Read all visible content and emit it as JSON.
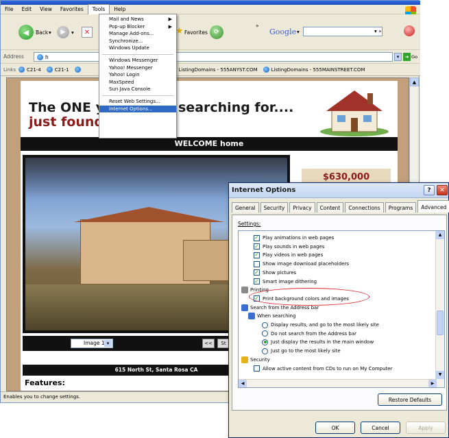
{
  "menubar": {
    "items": [
      "File",
      "Edit",
      "View",
      "Favorites",
      "Tools",
      "Help"
    ]
  },
  "toolbar": {
    "back": "Back",
    "favorites": "Favorites",
    "google": "Google"
  },
  "address": {
    "label": "Address",
    "value": "h",
    "go": "Go"
  },
  "links": {
    "label": "Links",
    "items": [
      "C21-4",
      "C21-1",
      "ListingDomains - 555ANYST.COM",
      "ListingDomains - 555MAINSTREET.COM"
    ]
  },
  "tools_menu": {
    "group1": [
      "Mail and News",
      "Pop-up Blocker",
      "Manage Add-ons...",
      "Synchronize...",
      "Windows Update"
    ],
    "group2": [
      "Windows Messenger",
      "Yahoo! Messenger",
      "Yahoo! Login",
      "MaxSpeed",
      "Sun Java Console"
    ],
    "group3": [
      "Reset Web Settings...",
      "Internet Options..."
    ]
  },
  "page": {
    "headline1": "The ONE y",
    "headline1b": "searching for....",
    "headline2": "just found",
    "welcome": "WELCOME home",
    "price": "$630,000",
    "image_select": "Image 1",
    "prev_btn": "<<",
    "next_btn": "St",
    "address_line": "615 North St, Santa Rosa CA",
    "features": "Features:"
  },
  "status": {
    "text": "Enables you to change settings."
  },
  "dialog": {
    "title": "Internet Options",
    "tabs": [
      "General",
      "Security",
      "Privacy",
      "Content",
      "Connections",
      "Programs",
      "Advanced"
    ],
    "settings_label": "Settings:",
    "rows": [
      {
        "kind": "check",
        "label": "Play animations in web pages",
        "checked": true
      },
      {
        "kind": "check",
        "label": "Play sounds in web pages",
        "checked": true
      },
      {
        "kind": "check",
        "label": "Play videos in web pages",
        "checked": true
      },
      {
        "kind": "check",
        "label": "Show image download placeholders",
        "checked": false
      },
      {
        "kind": "check",
        "label": "Show pictures",
        "checked": true
      },
      {
        "kind": "check",
        "label": "Smart image dithering",
        "checked": true
      },
      {
        "kind": "header",
        "label": "Printing"
      },
      {
        "kind": "check",
        "label": "Print background colors and images",
        "checked": true
      },
      {
        "kind": "header",
        "label": "Search from the Address bar"
      },
      {
        "kind": "subheader",
        "label": "When searching"
      },
      {
        "kind": "radio",
        "label": "Display results, and go to the most likely site",
        "checked": false
      },
      {
        "kind": "radio",
        "label": "Do not search from the Address bar",
        "checked": false
      },
      {
        "kind": "radio",
        "label": "Just display the results in the main window",
        "checked": true
      },
      {
        "kind": "radio",
        "label": "Just go to the most likely site",
        "checked": false
      },
      {
        "kind": "header",
        "label": "Security"
      },
      {
        "kind": "check",
        "label": "Allow active content from CDs to run on My Computer",
        "checked": false
      }
    ],
    "restore_defaults": "Restore Defaults",
    "ok": "OK",
    "cancel": "Cancel",
    "apply": "Apply"
  }
}
